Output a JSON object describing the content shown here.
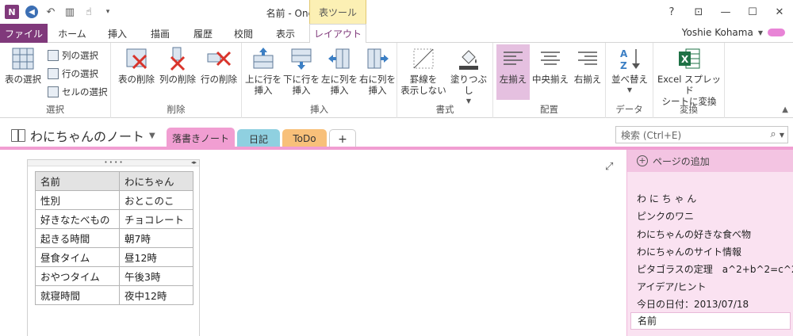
{
  "window": {
    "title": "名前 - OneNote",
    "context_tab_title": "表ツール",
    "app_icon": "N"
  },
  "ribbon_tabs": [
    "ファイル",
    "ホーム",
    "挿入",
    "描画",
    "履歴",
    "校閲",
    "表示",
    "レイアウト"
  ],
  "user": {
    "name": "Yoshie Kohama"
  },
  "ribbon": {
    "groups": {
      "select": {
        "label": "選択",
        "big": "表の選択",
        "small": [
          "列の選択",
          "行の選択",
          "セルの選択"
        ]
      },
      "delete": {
        "label": "削除",
        "buttons": [
          "表の削除",
          "列の削除",
          "行の削除"
        ]
      },
      "insert": {
        "label": "挿入",
        "buttons": [
          [
            "上に行を",
            "挿入"
          ],
          [
            "下に行を",
            "挿入"
          ],
          [
            "左に列を",
            "挿入"
          ],
          [
            "右に列を",
            "挿入"
          ]
        ]
      },
      "format": {
        "label": "書式",
        "buttons": [
          [
            "罫線を",
            "表示しない"
          ],
          [
            "塗りつぶし",
            ""
          ]
        ]
      },
      "align": {
        "label": "配置",
        "buttons": [
          "左揃え",
          "中央揃え",
          "右揃え"
        ]
      },
      "data": {
        "label": "データ",
        "buttons": [
          "並べ替え"
        ]
      },
      "convert": {
        "label": "変換",
        "buttons": [
          [
            "Excel スプレッド",
            "シートに変換"
          ]
        ]
      }
    }
  },
  "notebook": {
    "title": "わにちゃんのノート",
    "sections": [
      "落書きノート",
      "日記",
      "ToDo",
      "+"
    ]
  },
  "search": {
    "placeholder": "検索 (Ctrl+E)"
  },
  "table": {
    "rows": [
      [
        "名前",
        "わにちゃん"
      ],
      [
        "性別",
        "おとこのこ"
      ],
      [
        "好きなたべもの",
        "チョコレート"
      ],
      [
        "起きる時間",
        "朝7時"
      ],
      [
        "昼食タイム",
        "昼12時"
      ],
      [
        "おやつタイム",
        "午後3時"
      ],
      [
        "就寝時間",
        "夜中12時"
      ]
    ]
  },
  "page_list": {
    "add_label": "ページの追加",
    "items": [
      "わ に ち ゃ ん",
      "ピンクのワニ",
      "わにちゃんの好きな食べ物",
      "わにちゃんのサイト情報",
      "ピタゴラスの定理　a^2+b^2=c^2",
      "アイデア/ヒント",
      "今日の日付：2013/07/18",
      "名前"
    ],
    "selected_index": 7
  },
  "colors": {
    "brand": "#80397b",
    "section_drawing": "#f19ed2",
    "section_diary": "#8fd0e0",
    "section_todo": "#f8c07a",
    "context_tab": "#fcf0b4"
  }
}
